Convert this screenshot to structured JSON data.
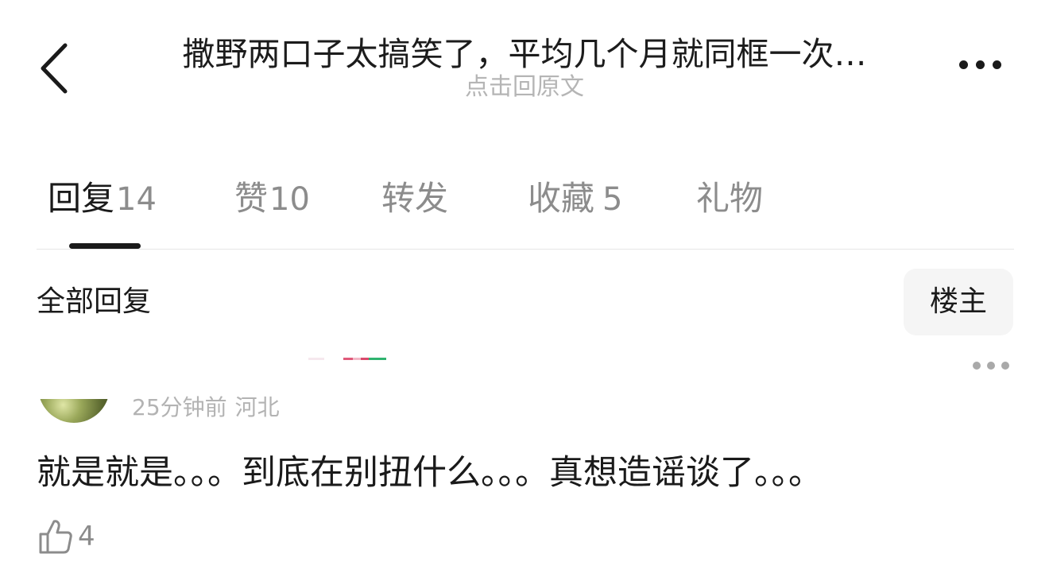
{
  "header": {
    "title": "撒野两口子太搞笑了，平均几个月就同框一次…",
    "subtitle": "点击回原文"
  },
  "tabs": [
    {
      "label": "回复",
      "count": "14"
    },
    {
      "label": "赞",
      "count": "10"
    },
    {
      "label": "转发",
      "count": ""
    },
    {
      "label": "收藏",
      "count": "5"
    },
    {
      "label": "礼物",
      "count": ""
    }
  ],
  "section": {
    "title": "全部回复",
    "owner_filter_label": "楼主"
  },
  "reply": {
    "time": "25分钟前",
    "location": "河北",
    "text": "就是就是。。。到底在别扭什么。。。真想造谣谈了。。。",
    "like_count": "4"
  },
  "icons": {
    "back": "chevron-left-icon",
    "more": "more-dots-icon",
    "like": "thumbs-up-icon"
  },
  "colors": {
    "text_primary": "#1a1a1a",
    "text_secondary": "#8c8c8c",
    "text_muted": "#b5b5b5",
    "button_bg": "#f5f5f5"
  }
}
